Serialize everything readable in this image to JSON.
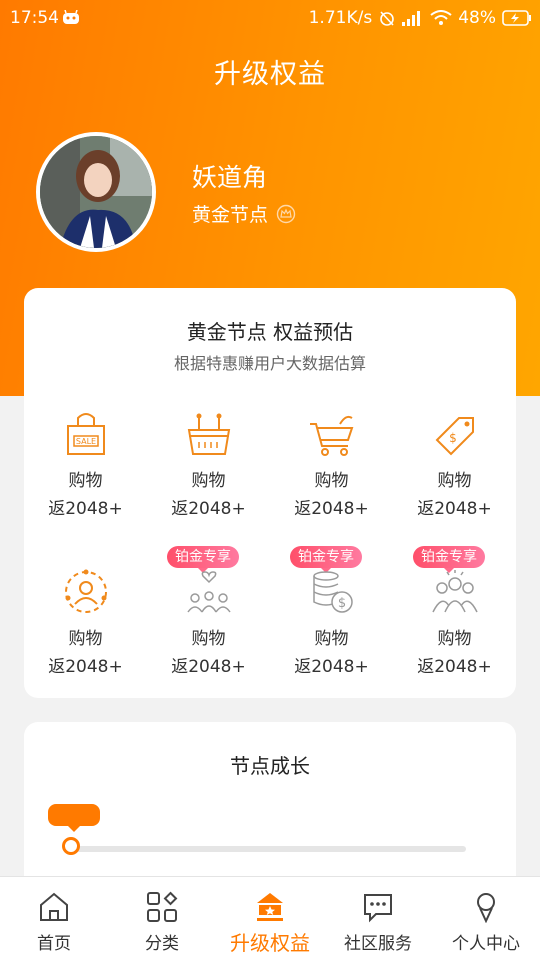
{
  "status": {
    "time": "17:54",
    "speed": "1.71K/s",
    "battery": "48%"
  },
  "header": {
    "title": "升级权益"
  },
  "profile": {
    "name": "妖道角",
    "level": "黄金节点"
  },
  "estimate": {
    "title": "黄金节点 权益预估",
    "subtitle": "根据特惠赚用户大数据估算",
    "items": [
      {
        "icon": "shopping-bag-sale-icon",
        "line1": "购物",
        "line2": "返2048+"
      },
      {
        "icon": "shopping-basket-icon",
        "line1": "购物",
        "line2": "返2048+"
      },
      {
        "icon": "shopping-cart-icon",
        "line1": "购物",
        "line2": "返2048+"
      },
      {
        "icon": "price-tag-icon",
        "line1": "购物",
        "line2": "返2048+"
      },
      {
        "icon": "user-network-icon",
        "line1": "购物",
        "line2": "返2048+"
      },
      {
        "icon": "community-group-icon",
        "line1": "购物",
        "line2": "返2048+",
        "badge": "铂金专享"
      },
      {
        "icon": "coins-dollar-icon",
        "line1": "购物",
        "line2": "返2048+",
        "badge": "铂金专享"
      },
      {
        "icon": "team-people-icon",
        "line1": "购物",
        "line2": "返2048+",
        "badge": "铂金专享"
      }
    ]
  },
  "growth": {
    "title": "节点成长",
    "progress": 0
  },
  "tabs": [
    {
      "label": "首页",
      "icon": "home-icon"
    },
    {
      "label": "分类",
      "icon": "category-grid-icon"
    },
    {
      "label": "升级权益",
      "icon": "upgrade-crown-icon",
      "active": true
    },
    {
      "label": "社区服务",
      "icon": "chat-bubble-icon"
    },
    {
      "label": "个人中心",
      "icon": "person-icon"
    }
  ],
  "colors": {
    "accent": "#ff7a00",
    "badge": "#ff5a78"
  }
}
